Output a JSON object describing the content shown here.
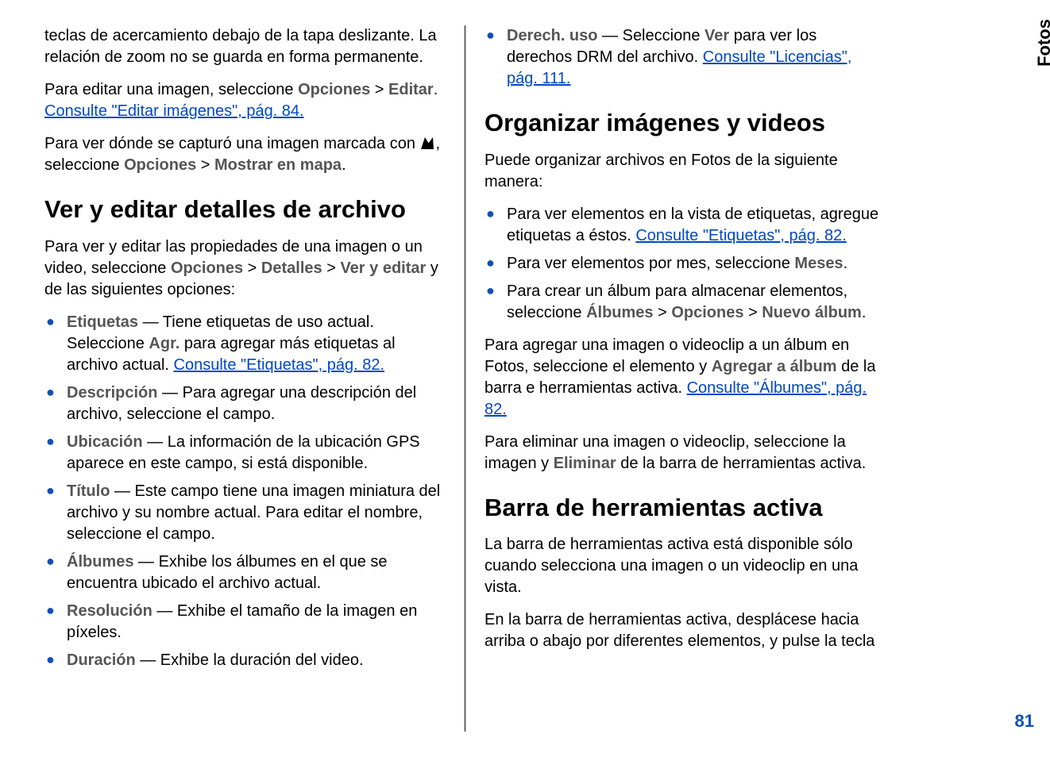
{
  "sidebar": {
    "label": "Fotos",
    "page_number": "81"
  },
  "left": {
    "p1": "teclas de acercamiento debajo de la tapa deslizante. La relación de zoom no se guarda en forma permanente.",
    "p2_a": "Para editar una imagen, seleccione ",
    "p2_opciones": "Opciones",
    "p2_gt": " > ",
    "p2_editar": "Editar",
    "p2_dot": ". ",
    "p2_link": "Consulte \"Editar imágenes\", pág. 84.",
    "p3_a": "Para ver dónde se capturó una imagen marcada con ",
    "p3_b": ", seleccione ",
    "p3_opciones": "Opciones",
    "p3_gt": " > ",
    "p3_mostrar": "Mostrar en mapa",
    "p3_dot": ".",
    "h1": "Ver y editar detalles de archivo",
    "p4_a": "Para ver y editar las propiedades de una imagen o un video, seleccione ",
    "p4_opciones": "Opciones",
    "p4_gt": " > ",
    "p4_detalles": "Detalles",
    "p4_gt2": " > ",
    "p4_ver": "Ver y editar",
    "p4_b": " y de las siguientes opciones:",
    "items": [
      {
        "label": "Etiquetas",
        "rest_a": " — Tiene etiquetas de uso actual. Seleccione ",
        "bold2": "Agr.",
        "rest_b": " para agregar más etiquetas al archivo actual. ",
        "link": "Consulte \"Etiquetas\", pág. 82."
      },
      {
        "label": "Descripción",
        "rest_a": " — Para agregar una descripción del archivo, seleccione el campo."
      },
      {
        "label": "Ubicación",
        "rest_a": " — La información de la ubicación GPS aparece en este campo, si está disponible."
      },
      {
        "label": "Título",
        "rest_a": " — Este campo tiene una imagen miniatura del archivo y su nombre actual. Para editar el nombre, seleccione el campo."
      },
      {
        "label": "Álbumes",
        "rest_a": " — Exhibe los álbumes en el que se encuentra ubicado el archivo actual."
      },
      {
        "label": "Resolución",
        "rest_a": " — Exhibe el tamaño de la imagen en píxeles."
      },
      {
        "label": "Duración",
        "rest_a": " — Exhibe la duración del video."
      }
    ]
  },
  "right": {
    "topitem": {
      "label": "Derech. uso",
      "rest_a": " — Seleccione ",
      "bold2": "Ver",
      "rest_b": " para ver los derechos DRM del archivo. ",
      "link": "Consulte \"Licencias\", pág. 111."
    },
    "h1": "Organizar imágenes y videos",
    "p1": "Puede organizar archivos en Fotos de la siguiente manera:",
    "items": [
      {
        "rest_a": "Para ver elementos en la vista de etiquetas, agregue etiquetas a éstos. ",
        "link": "Consulte \"Etiquetas\", pág. 82."
      },
      {
        "rest_a": "Para ver elementos por mes, seleccione ",
        "bold2": "Meses",
        "rest_b": "."
      },
      {
        "rest_a": "Para crear un álbum para almacenar elementos, seleccione ",
        "bold2": "Álbumes",
        "gt": " > ",
        "bold3": "Opciones",
        "gt2": " > ",
        "bold4": "Nuevo álbum",
        "rest_b": "."
      }
    ],
    "p2_a": "Para agregar una imagen o videoclip a un álbum en Fotos, seleccione el elemento y ",
    "p2_bold": "Agregar a álbum",
    "p2_b": " de la barra e herramientas activa. ",
    "p2_link": "Consulte \"Álbumes\", pág. 82.",
    "p3_a": "Para eliminar una imagen o videoclip, seleccione la imagen y ",
    "p3_bold": "Eliminar",
    "p3_b": " de la barra de herramientas activa.",
    "h2": "Barra de herramientas activa",
    "p4": "La barra de herramientas activa está disponible sólo cuando selecciona una imagen o un videoclip en una vista.",
    "p5": "En la barra de herramientas activa, desplácese hacia arriba o abajo por diferentes elementos, y pulse la tecla"
  }
}
